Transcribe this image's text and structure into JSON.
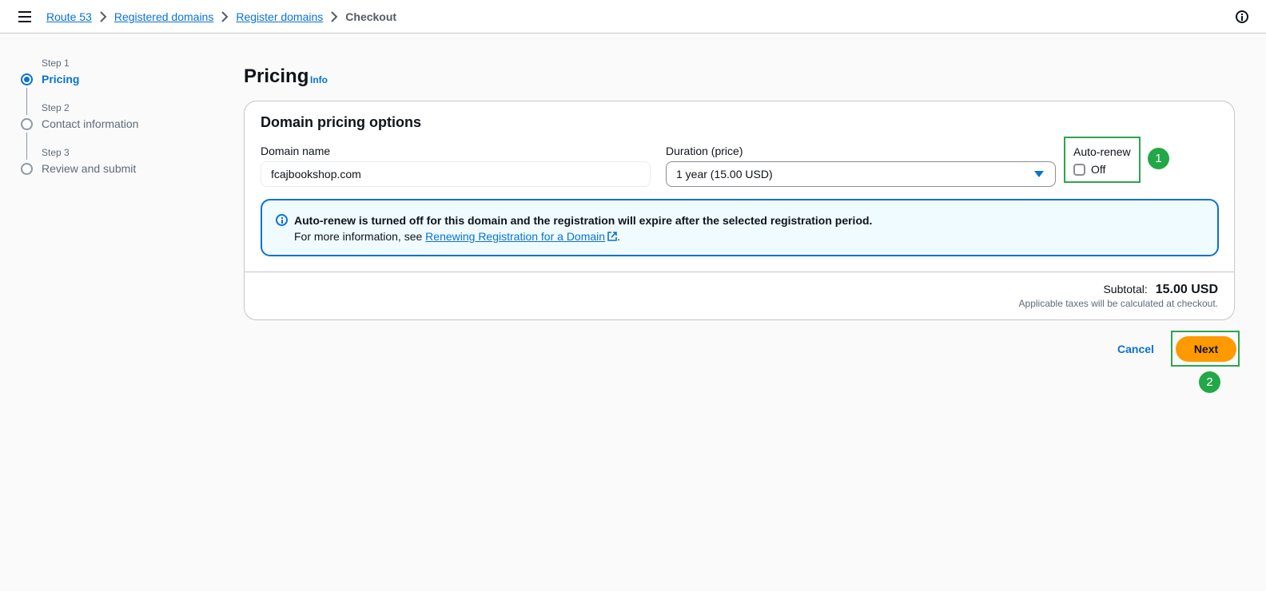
{
  "breadcrumb": {
    "items": [
      "Route 53",
      "Registered domains",
      "Register domains"
    ],
    "current": "Checkout"
  },
  "steps": [
    {
      "number": "Step 1",
      "label": "Pricing",
      "active": true
    },
    {
      "number": "Step 2",
      "label": "Contact information",
      "active": false
    },
    {
      "number": "Step 3",
      "label": "Review and submit",
      "active": false
    }
  ],
  "page": {
    "title": "Pricing",
    "info_link": "Info"
  },
  "card": {
    "title": "Domain pricing options",
    "domain_name_label": "Domain name",
    "domain_name_value": "fcajbookshop.com",
    "duration_label": "Duration (price)",
    "duration_value": "1 year (15.00 USD)",
    "autorenew_label": "Auto-renew",
    "autorenew_state": "Off",
    "autorenew_checked": false
  },
  "alert": {
    "title": "Auto-renew is turned off for this domain and the registration will expire after the selected registration period.",
    "body_prefix": "For more information, see ",
    "link_text": "Renewing Registration for a Domain",
    "body_suffix": "."
  },
  "totals": {
    "subtotal_label": "Subtotal:",
    "subtotal_value": "15.00 USD",
    "tax_note": "Applicable taxes will be calculated at checkout."
  },
  "actions": {
    "cancel_label": "Cancel",
    "next_label": "Next"
  },
  "annotations": [
    "1",
    "2"
  ],
  "colors": {
    "accent": "#0972d3",
    "primary_button": "#ff9900",
    "annotation_green": "#22a846"
  }
}
